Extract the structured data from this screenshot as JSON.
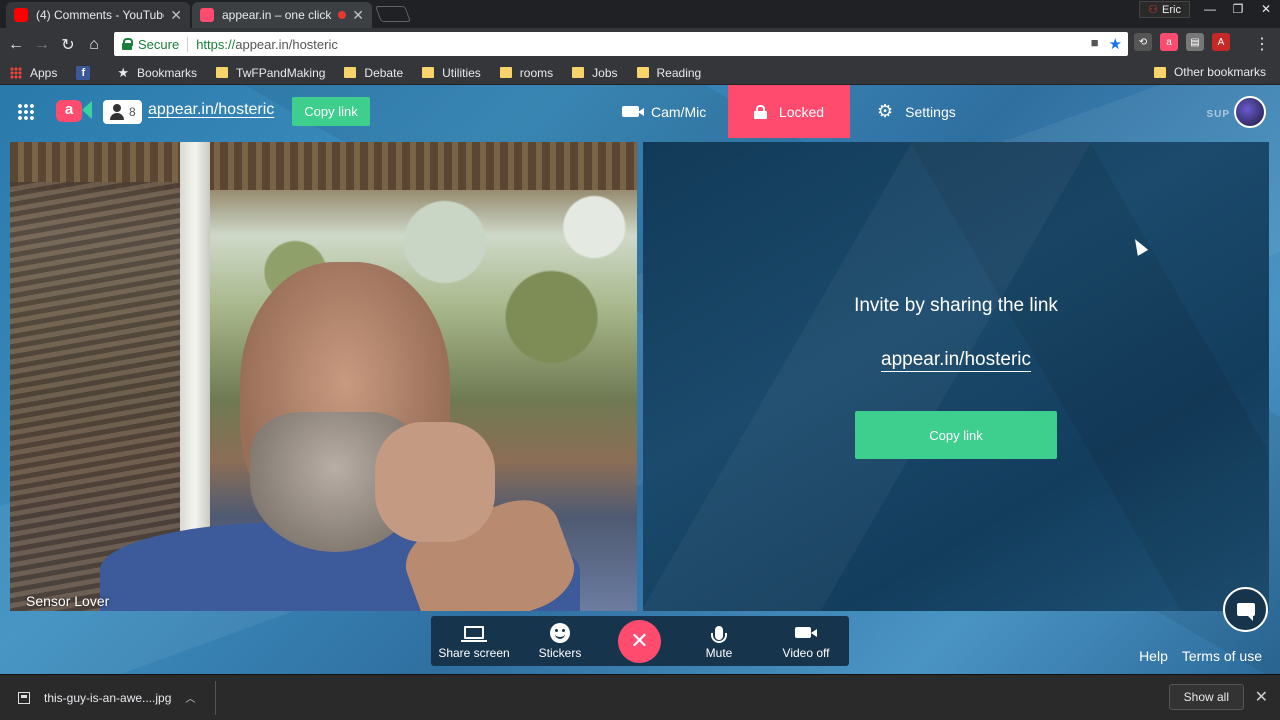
{
  "browser": {
    "tabs": [
      {
        "title": "(4) Comments - YouTube",
        "favicon_color": "#ff0000"
      },
      {
        "title": "appear.in – one click",
        "favicon_color": "#ff4b6e"
      }
    ],
    "profile_name": "Eric",
    "secure_label": "Secure",
    "url_scheme": "https://",
    "url_host": "appear.in",
    "url_path": "/hosteric",
    "bookmarks": [
      {
        "label": "Apps",
        "icon": "apps-grid-icon"
      },
      {
        "label": "",
        "icon": "facebook-icon"
      },
      {
        "label": "Bookmarks",
        "icon": "star-icon"
      },
      {
        "label": "TwFPandMaking",
        "icon": "folder-icon"
      },
      {
        "label": "Debate",
        "icon": "folder-icon"
      },
      {
        "label": "Utilities",
        "icon": "folder-icon"
      },
      {
        "label": "rooms",
        "icon": "folder-icon"
      },
      {
        "label": "Jobs",
        "icon": "folder-icon"
      },
      {
        "label": "Reading",
        "icon": "folder-icon"
      }
    ],
    "other_bookmarks": "Other bookmarks"
  },
  "app": {
    "participant_count": "8",
    "room_link": "appear.in/hosteric",
    "copy_link_label": "Copy link",
    "cam_mic_label": "Cam/Mic",
    "locked_label": "Locked",
    "settings_label": "Settings",
    "video_name": "Sensor Lover",
    "invite": {
      "title": "Invite by sharing the link",
      "link": "appear.in/hosteric",
      "button": "Copy link"
    },
    "toolbar": {
      "share_screen": "Share screen",
      "stickers": "Stickers",
      "mute": "Mute",
      "video_off": "Video off"
    },
    "footer": {
      "help": "Help",
      "terms": "Terms of use"
    },
    "accent_color": "#ff4b6e",
    "button_color": "#3ecf8e"
  },
  "downloads": {
    "file_name": "this-guy-is-an-awe....jpg",
    "show_all": "Show all"
  }
}
